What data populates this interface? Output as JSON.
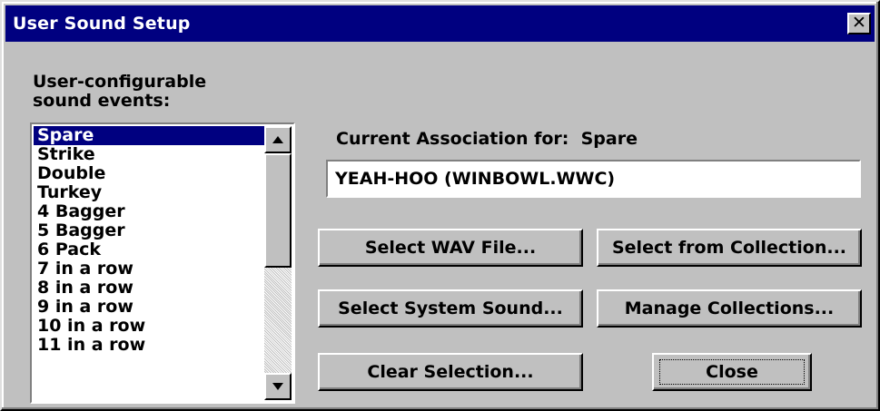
{
  "window": {
    "title": "User Sound Setup",
    "close_glyph": "✕"
  },
  "events": {
    "label_line1": "User-configurable",
    "label_line2": "sound events:",
    "items": [
      "Spare",
      "Strike",
      "Double",
      "Turkey",
      "4 Bagger",
      "5 Bagger",
      "6 Pack",
      "7 in a row",
      "8 in a row",
      "9 in a row",
      "10 in a row",
      "11 in a row"
    ],
    "selected": "Spare"
  },
  "association": {
    "label": "Current Association for:  Spare",
    "value": "YEAH-HOO (WINBOWL.WWC)"
  },
  "buttons": {
    "select_wav": "Select WAV File...",
    "select_collection": "Select from Collection...",
    "select_system": "Select System Sound...",
    "manage_collections": "Manage Collections...",
    "clear_selection": "Clear Selection...",
    "close": "Close"
  }
}
